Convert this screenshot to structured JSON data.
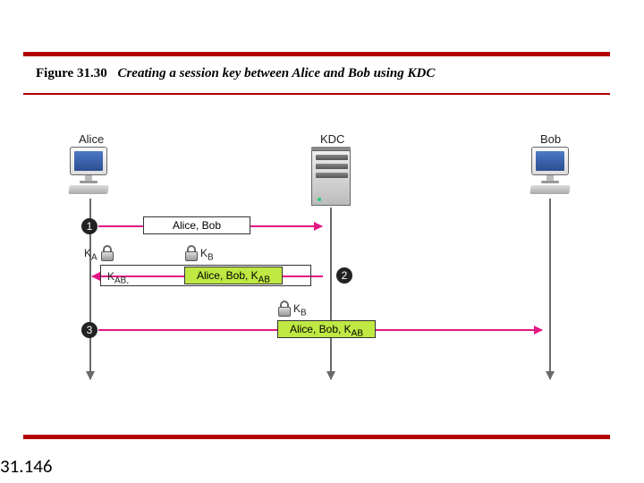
{
  "figure": {
    "number": "Figure 31.30",
    "title": "Creating a session key between Alice and Bob using KDC"
  },
  "page_number": "31.146",
  "entities": {
    "alice": "Alice",
    "kdc": "KDC",
    "bob": "Bob"
  },
  "steps": {
    "s1": "1",
    "s2": "2",
    "s3": "3"
  },
  "keys": {
    "ka": "K",
    "ka_sub": "A",
    "kb": "K",
    "kb_sub": "B",
    "kab": "K",
    "kab_suffix": "AB,"
  },
  "messages": {
    "m1": "Alice, Bob",
    "m2_inner": "Alice, Bob, K",
    "m2_inner_sub": "AB",
    "m3_inner": "Alice, Bob, K",
    "m3_inner_sub": "AB"
  },
  "chart_data": {
    "type": "sequence-diagram",
    "participants": [
      "Alice",
      "KDC",
      "Bob"
    ],
    "messages": [
      {
        "step": 1,
        "from": "Alice",
        "to": "KDC",
        "content": "Alice, Bob",
        "encrypted_with": null
      },
      {
        "step": 2,
        "from": "KDC",
        "to": "Alice",
        "content": "K_AB, { Alice, Bob, K_AB }_K_B",
        "encrypted_with": "K_A",
        "inner_ticket": {
          "content": "Alice, Bob, K_AB",
          "encrypted_with": "K_B"
        }
      },
      {
        "step": 3,
        "from": "Alice",
        "to": "Bob",
        "content": "Alice, Bob, K_AB",
        "encrypted_with": "K_B"
      }
    ]
  }
}
